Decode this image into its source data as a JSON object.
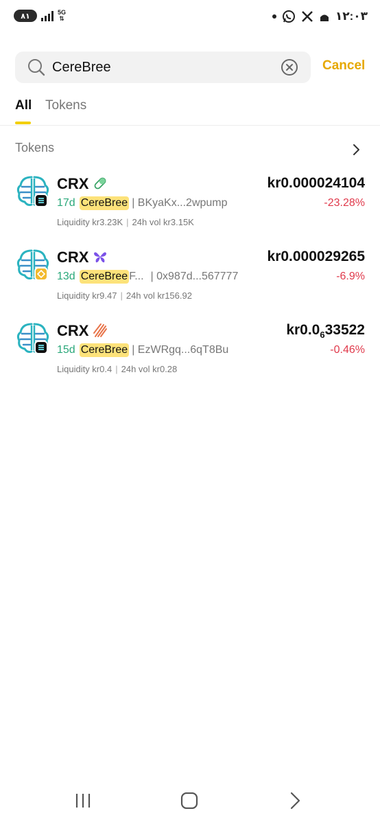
{
  "status_bar": {
    "battery": "۸۱",
    "network": "5G",
    "time": "۱۲:۰۳"
  },
  "search": {
    "query": "CereBree",
    "cancel_label": "Cancel"
  },
  "tabs": [
    {
      "label": "All",
      "active": true
    },
    {
      "label": "Tokens",
      "active": false
    }
  ],
  "section": {
    "title": "Tokens"
  },
  "tokens": [
    {
      "symbol": "CRX",
      "chain": "solana",
      "dex_icon": "pill-icon",
      "price": "kr0.000024104",
      "age": "17d",
      "name": "CereBree",
      "name_suffix": "",
      "address": "| BKyaKx...2wpump",
      "change": "-23.28%",
      "liquidity": "Liquidity kr3.23K",
      "volume": "24h vol kr3.15K"
    },
    {
      "symbol": "CRX",
      "chain": "bnb",
      "dex_icon": "butterfly-icon",
      "price": "kr0.000029265",
      "age": "13d",
      "name": "CereBree",
      "name_suffix": " F...",
      "address": "| 0x987d...567777",
      "change": "-6.9%",
      "liquidity": "Liquidity kr9.47",
      "volume": "24h vol kr156.92"
    },
    {
      "symbol": "CRX",
      "chain": "solana",
      "dex_icon": "stripes-icon",
      "price_prefix": "kr0.0",
      "price_sub": "6",
      "price_suffix": "33522",
      "age": "15d",
      "name": "CereBree",
      "name_suffix": "",
      "address": "| EzWRgq...6qT8Bu",
      "change": "-0.46%",
      "liquidity": "Liquidity kr0.4",
      "volume": "24h vol kr0.28"
    }
  ],
  "colors": {
    "accent": "#e6a800",
    "tab_indicator": "#f2cf00",
    "highlight": "#fde27a",
    "negative": "#e0394b",
    "age": "#2aa87a"
  }
}
